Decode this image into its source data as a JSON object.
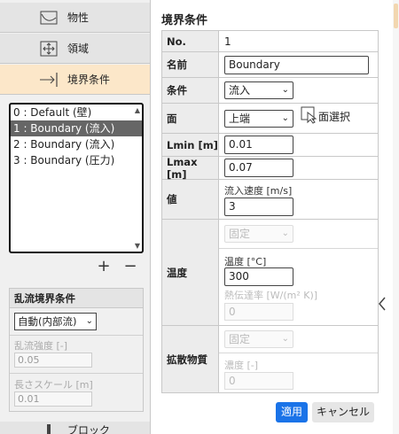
{
  "nav": {
    "properties": "物性",
    "region": "領域",
    "boundary": "境界条件",
    "block": "ブロック"
  },
  "boundary_list": {
    "items": [
      "0 : Default (壁)",
      "1 : Boundary (流入)",
      "2 : Boundary (流入)",
      "3 : Boundary (圧力)"
    ],
    "selected_index": 1
  },
  "list_controls": {
    "add": "+",
    "remove": "−"
  },
  "turbulence": {
    "title": "乱流境界条件",
    "mode": "自動(内部流)",
    "intensity_label": "乱流強度 [-]",
    "intensity_value": "0.05",
    "length_label": "長さスケール [m]",
    "length_value": "0.01"
  },
  "panel": {
    "title": "境界条件",
    "rows": {
      "no_label": "No.",
      "no_value": "1",
      "name_label": "名前",
      "name_value": "Boundary",
      "condition_label": "条件",
      "condition_value": "流入",
      "face_label": "面",
      "face_value": "上端",
      "face_select": "面選択",
      "lmin_label": "Lmin [m]",
      "lmin_value": "0.01",
      "lmax_label": "Lmax [m]",
      "lmax_value": "0.07",
      "value_label": "値",
      "inflow_velocity_label": "流入速度 [m/s]",
      "inflow_velocity_value": "3",
      "temp_label": "温度",
      "temp_mode": "固定",
      "temperature_label": "温度 [°C]",
      "temperature_value": "300",
      "heat_transfer_label": "熱伝達率 [W/(m² K)]",
      "heat_transfer_value": "0",
      "diffusion_label": "拡散物質",
      "diffusion_mode": "固定",
      "concentration_label": "濃度 [-]",
      "concentration_value": "0"
    },
    "apply": "適用",
    "cancel": "キャンセル"
  },
  "icons": {
    "properties": "curve-graph-icon",
    "region": "move-arrows-icon",
    "boundary": "arrow-to-line-icon",
    "face_select": "cursor-select-icon",
    "collapse": "chevron-left-icon"
  }
}
